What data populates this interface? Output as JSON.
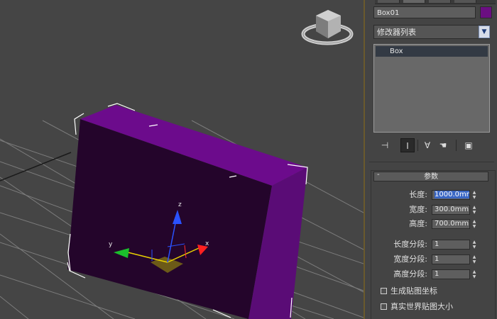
{
  "viewport": {
    "gizmo_axes": {
      "x": "x",
      "y": "y",
      "z": "z"
    },
    "viewcube_icon": "viewcube-icon",
    "box_color": "#4d0d60",
    "box_side_color": "#5a0c76",
    "box_top_color": "#6c0b8c",
    "grid_color": "#7a7a7a"
  },
  "panel": {
    "object_name": "Box01",
    "object_color": "#6b0e82",
    "modifier_list": "修改器列表",
    "stack_item": "Box",
    "tools": [
      "pin-icon",
      "show-end-result-icon",
      "make-unique-icon",
      "remove-modifier-icon",
      "configure-sets-icon"
    ],
    "rollout_title": "参数",
    "rollout_toggle": "-",
    "params": {
      "length_label": "长度:",
      "length_value": "1000.0mm",
      "width_label": "宽度:",
      "width_value": "300.0mm",
      "height_label": "高度:",
      "height_value": "700.0mm",
      "length_segs_label": "长度分段:",
      "length_segs_value": "1",
      "width_segs_label": "宽度分段:",
      "width_segs_value": "1",
      "height_segs_label": "高度分段:",
      "height_segs_value": "1"
    },
    "checks": {
      "gen_mapping_label": "生成贴图坐标",
      "real_world_label": "真实世界贴图大小"
    }
  }
}
